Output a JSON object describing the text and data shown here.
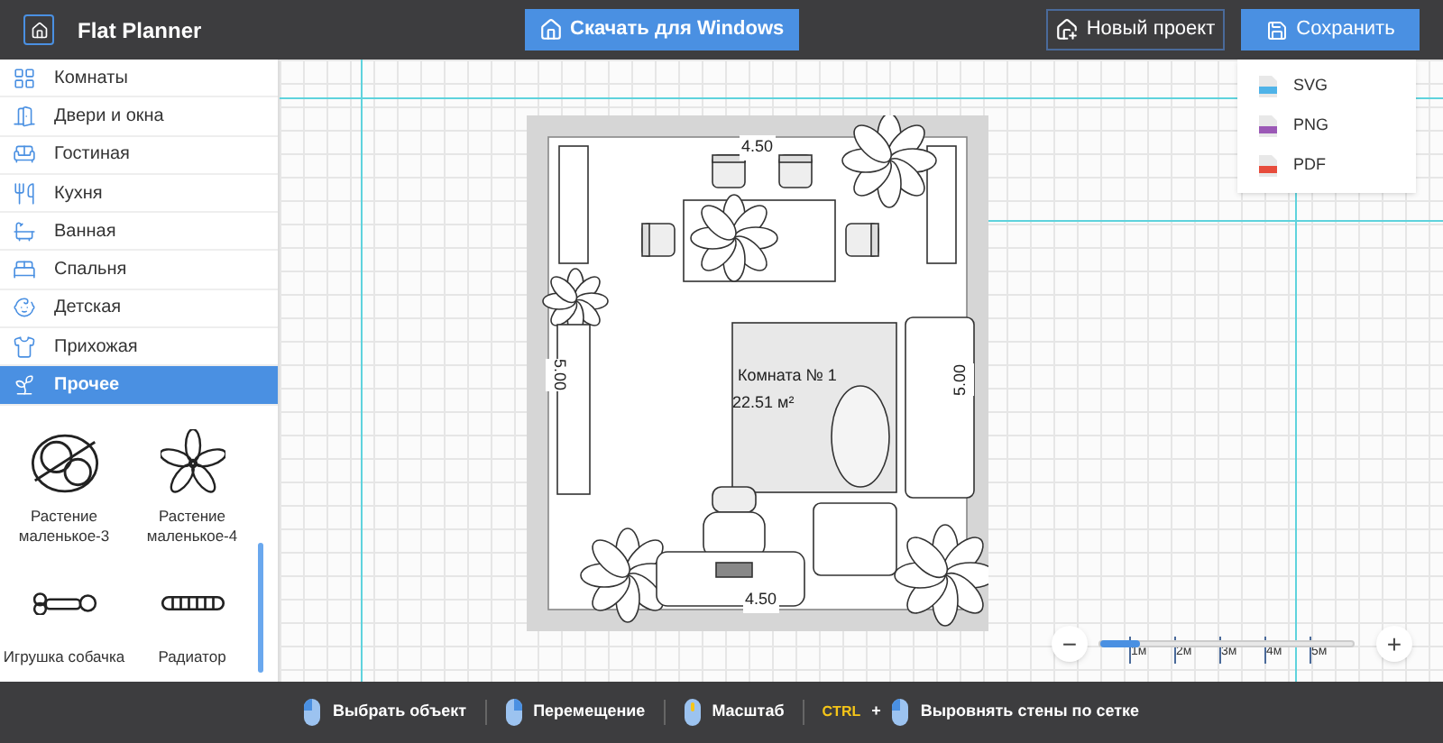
{
  "header": {
    "title": "Flat Planner",
    "download_button": "Скачать для Windows",
    "new_project_button": "Новый проект",
    "save_button": "Сохранить"
  },
  "save_menu": [
    {
      "label": "SVG",
      "color": "#4fb3e8"
    },
    {
      "label": "PNG",
      "color": "#9b59b6"
    },
    {
      "label": "PDF",
      "color": "#e74c3c"
    }
  ],
  "sidebar": {
    "items": [
      {
        "label": "Комнаты",
        "selected": false
      },
      {
        "label": "Двери и окна",
        "selected": false
      },
      {
        "label": "Гостиная",
        "selected": false
      },
      {
        "label": "Кухня",
        "selected": false
      },
      {
        "label": "Ванная",
        "selected": false
      },
      {
        "label": "Спальня",
        "selected": false
      },
      {
        "label": "Детская",
        "selected": false
      },
      {
        "label": "Прихожая",
        "selected": false
      },
      {
        "label": "Прочее",
        "selected": true
      }
    ]
  },
  "catalog": [
    {
      "label": "Растение маленькое-3"
    },
    {
      "label": "Растение маленькое-4"
    },
    {
      "label": "Игрушка собачка"
    },
    {
      "label": "Радиатор"
    }
  ],
  "plan": {
    "top_dimension": "4.50",
    "bottom_dimension": "4.50",
    "left_dimension": "5.00",
    "right_dimension": "5.00",
    "room_name": "Комната № 1",
    "room_area": "22.51 м²"
  },
  "zoom": {
    "minus": "−",
    "plus": "+",
    "level": 0.16,
    "ticks": [
      "1м",
      "2м",
      "3м",
      "4м",
      "5м"
    ]
  },
  "status_bar": [
    {
      "kind": "left",
      "label": "Выбрать объект"
    },
    {
      "kind": "right",
      "label": "Перемещение"
    },
    {
      "kind": "wheel",
      "label": "Масштаб"
    },
    {
      "kind": "left",
      "key": "CTRL",
      "plus": "+",
      "label": "Выровнять стены по сетке"
    }
  ]
}
